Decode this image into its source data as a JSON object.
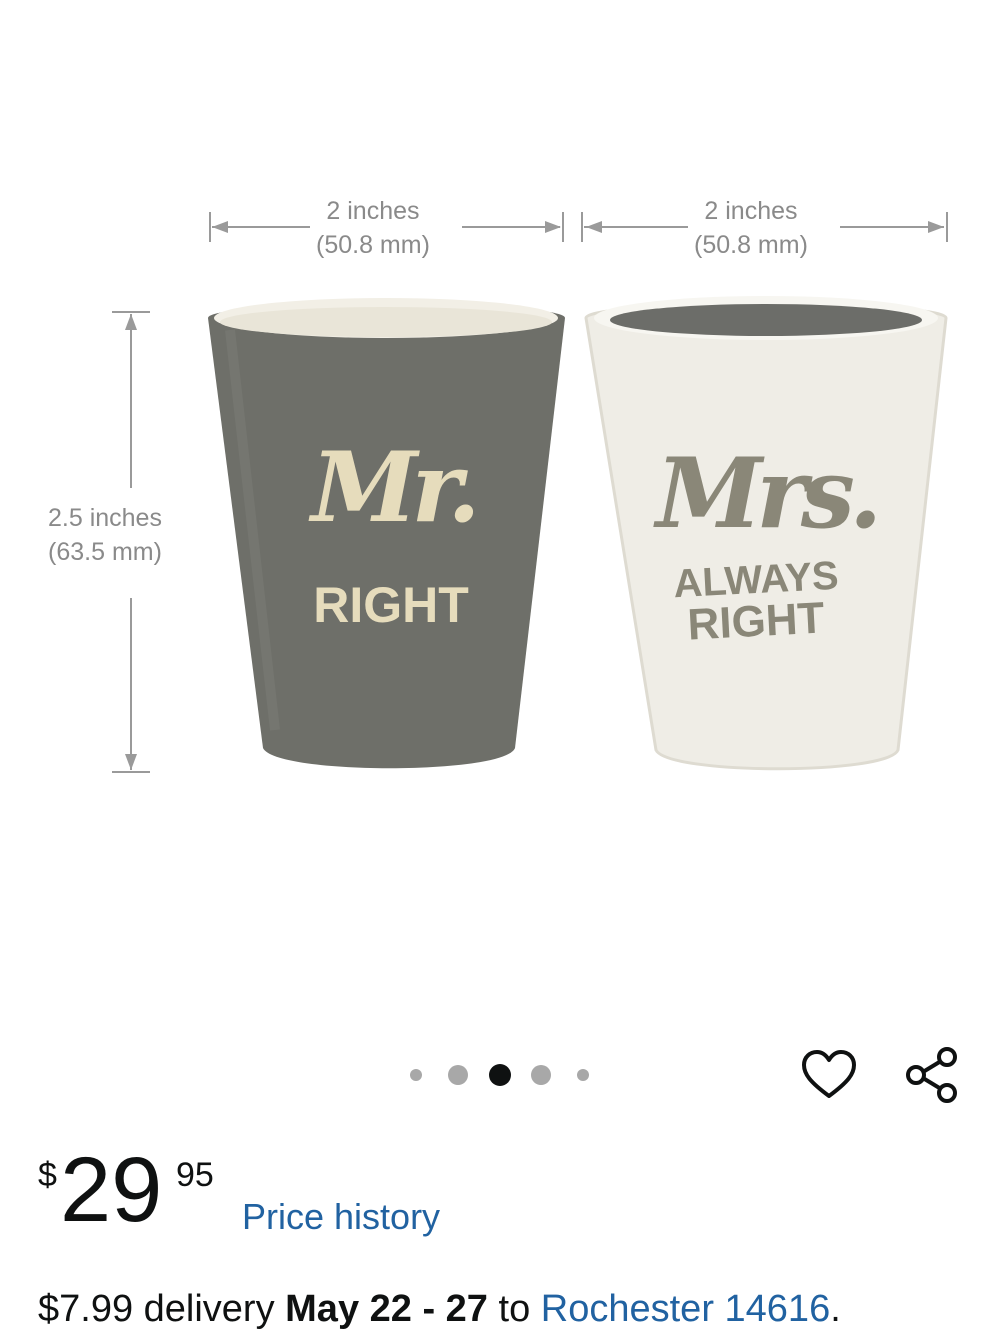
{
  "product_image": {
    "width_label_left_line1": "2 inches",
    "width_label_left_line2": "(50.8 mm)",
    "width_label_right_line1": "2 inches",
    "width_label_right_line2": "(50.8 mm)",
    "height_label_line1": "2.5 inches",
    "height_label_line2": "(63.5 mm)",
    "left_cup_script": "Mr.",
    "left_cup_text": "RIGHT",
    "right_cup_script": "Mrs.",
    "right_cup_text_line1": "ALWAYS",
    "right_cup_text_line2": "RIGHT"
  },
  "carousel": {
    "total_images": 5,
    "active_index": 2
  },
  "actions": {
    "wishlist_icon": "heart-outline-icon",
    "share_icon": "share-icon"
  },
  "price": {
    "symbol": "$",
    "whole": "29",
    "fraction": "95",
    "history_link": "Price history"
  },
  "delivery": {
    "fee": "$7.99 delivery",
    "date": "May 22 - 27",
    "to": "to",
    "location": "Rochester 14616",
    "end": "."
  },
  "colors": {
    "gray_cup": "#6e6f69",
    "cream_cup": "#efede6",
    "print_cream": "#e6dcbc",
    "print_gray": "#8a8778",
    "link": "#2162a1",
    "text": "#0f1111"
  }
}
